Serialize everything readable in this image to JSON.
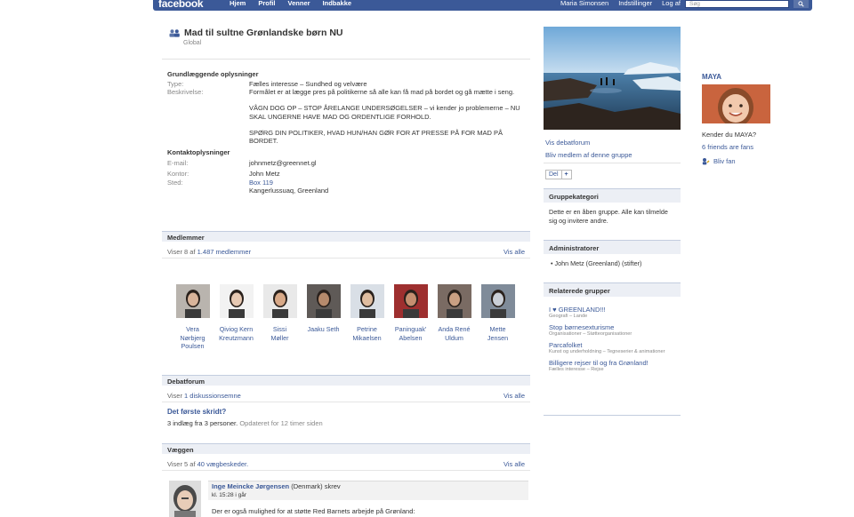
{
  "topbar": {
    "logo": "facebook",
    "nav": [
      "Hjem",
      "Profil",
      "Venner",
      "Indbakke"
    ],
    "user": [
      "Maria Simonsen",
      "Indstillinger",
      "Log af"
    ],
    "search_placeholder": "Søg"
  },
  "group": {
    "title": "Mad til sultne Grønlandske børn NU",
    "subtitle": "Global"
  },
  "basic_info": {
    "heading": "Grundlæggende oplysninger",
    "type_label": "Type:",
    "type_value": "Fælles interesse – Sundhed og velvære",
    "desc_label": "Beskrivelse:",
    "desc_p1": "Formålet er at lægge pres på politikerne så alle kan få mad på bordet og gå mætte i seng.",
    "desc_p2": "VÅGN DOG OP – STOP ÅRELANGE UNDERSØGELSER – vi kender jo problemerne – NU SKAL UNGERNE HAVE MAD OG ORDENTLIGE FORHOLD.",
    "desc_p3": "SPØRG DIN POLITIKER, HVAD HUN/HAN GØR FOR AT PRESSE PÅ FOR MAD PÅ BORDET."
  },
  "contact": {
    "heading": "Kontaktoplysninger",
    "email_label": "E-mail:",
    "email_value": "johnmetz@greennet.gl",
    "office_label": "Kontor:",
    "office_value": "John Metz",
    "place_label": "Sted:",
    "place_line1": "Box 119",
    "place_line2": "Kangerlussuaq, Greenland"
  },
  "members": {
    "heading": "Medlemmer",
    "count_prefix": "Viser 8 af",
    "count_link": "1.487 medlemmer",
    "see_all": "Vis alle",
    "list": [
      {
        "name1": "Vera",
        "name2": "Nørbjerg",
        "name3": "Poulsen",
        "skin": "#d9b49a",
        "bg": "#b9b4ae"
      },
      {
        "name1": "Qiviog Kern",
        "name2": "Kreutzmann",
        "name3": "",
        "skin": "#e7c9b3",
        "bg": "#f2f2f2"
      },
      {
        "name1": "Sissi",
        "name2": "Møller",
        "name3": "",
        "skin": "#d8a988",
        "bg": "#e9e9e9"
      },
      {
        "name1": "Jaaku Seth",
        "name2": "",
        "name3": "",
        "skin": "#b68a6c",
        "bg": "#5f5a57"
      },
      {
        "name1": "Petrine",
        "name2": "Mikaelsen",
        "name3": "",
        "skin": "#e0bda0",
        "bg": "#d9dfe6"
      },
      {
        "name1": "Paninguak'",
        "name2": "Abelsen",
        "name3": "",
        "skin": "#c58f70",
        "bg": "#9e2f2f"
      },
      {
        "name1": "Anda René",
        "name2": "Uldum",
        "name3": "",
        "skin": "#caa083",
        "bg": "#7a6b63"
      },
      {
        "name1": "Mette",
        "name2": "Jensen",
        "name3": "",
        "skin": "#c9ced6",
        "bg": "#7f8b99"
      }
    ]
  },
  "forum": {
    "heading": "Debatforum",
    "count_prefix": "Viser",
    "count_link": "1 diskussionsemne",
    "see_all": "Vis alle",
    "topic_title": "Det første skridt?",
    "topic_meta": "3 indlæg fra 3 personer.",
    "topic_updated": "Opdateret for 12 timer siden"
  },
  "wall": {
    "heading": "Væggen",
    "count_prefix": "Viser 5 af",
    "count_link": "40 vægbeskeder.",
    "see_all": "Vis alle",
    "post_author": "Inge Meincke Jørgensen",
    "post_country": "(Denmark) skrev",
    "post_time": "kl. 15:28 i går",
    "post_text": "Der er også mulighed for at støtte Red Barnets arbejde på Grønland:"
  },
  "sidebar": {
    "link_forum": "Vis debatforum",
    "link_join": "Bliv medlem af denne gruppe",
    "share": "Del",
    "share_plus": "+",
    "category_heading": "Gruppekategori",
    "category_text": "Dette er en åben gruppe. Alle kan tilmelde sig og invitere andre.",
    "admin_heading": "Administratorer",
    "admin_item": "John Metz (Greenland) (stifter)",
    "related_heading": "Relaterede grupper",
    "related": [
      {
        "title": "I ♥ GREENLAND!!!",
        "sub": "Geografi – Lande"
      },
      {
        "title": "Stop børnesexturisme",
        "sub": "Organisationer – Støtteorganisationer"
      },
      {
        "title": "Parcafolket",
        "sub": "Kunst og underholdning – Tegneserier & animationer"
      },
      {
        "title": "Billigere rejser til og fra Grønland!",
        "sub": "Fælles interesse – Rejse"
      }
    ]
  },
  "ad": {
    "title": "MAYA",
    "text": "Kender du MAYA?",
    "fans": "6 friends are fans",
    "fan_button": "Bliv fan"
  }
}
